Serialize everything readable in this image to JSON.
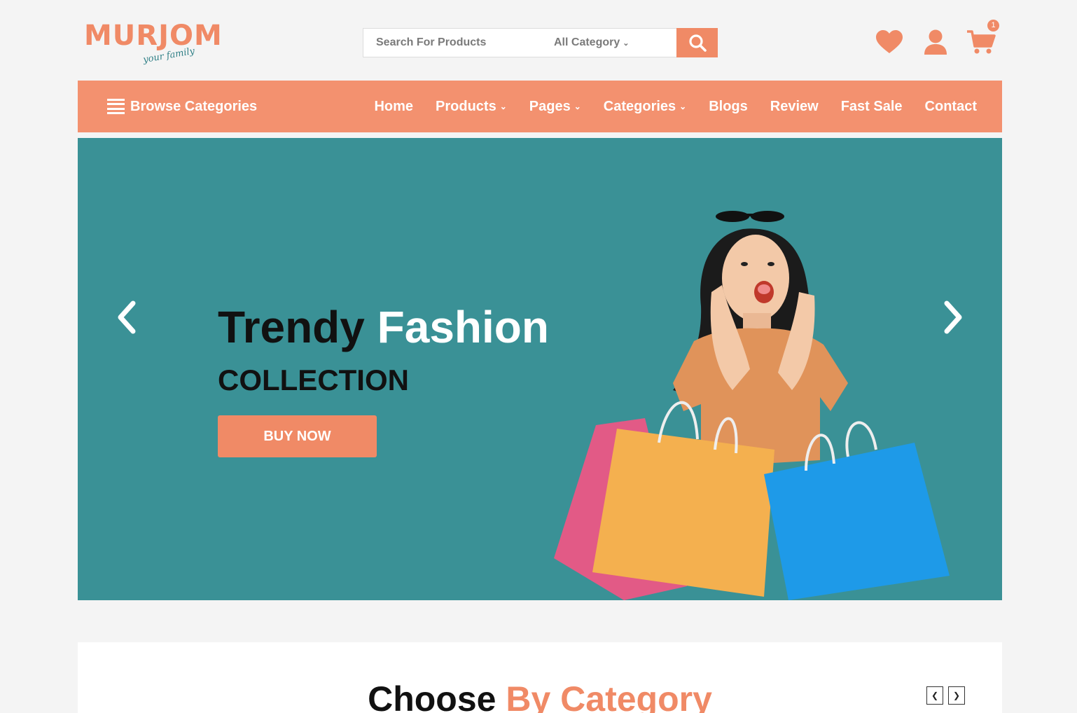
{
  "brand": {
    "name": "MURJOM",
    "tagline": "your family",
    "accent": "#f08a66",
    "teal": "#3a9196"
  },
  "search": {
    "placeholder": "Search For Products",
    "category": "All Category",
    "button_icon": "search-icon"
  },
  "header_icons": {
    "wishlist": "heart-icon",
    "account": "user-icon",
    "cart": "cart-icon",
    "cart_count": "1"
  },
  "nav": {
    "browse_label": "Browse Categories",
    "items": [
      {
        "label": "Home",
        "dropdown": false
      },
      {
        "label": "Products",
        "dropdown": true
      },
      {
        "label": "Pages",
        "dropdown": true
      },
      {
        "label": "Categories",
        "dropdown": true
      },
      {
        "label": "Blogs",
        "dropdown": false
      },
      {
        "label": "Review",
        "dropdown": false
      },
      {
        "label": "Fast Sale",
        "dropdown": false
      },
      {
        "label": "Contact",
        "dropdown": false
      }
    ]
  },
  "hero": {
    "title_dark": "Trendy",
    "title_light": "Fashion",
    "subtitle": "COLLECTION",
    "button": "BUY NOW"
  },
  "category_section": {
    "title_dark": "Choose",
    "title_accent": "By Category"
  }
}
